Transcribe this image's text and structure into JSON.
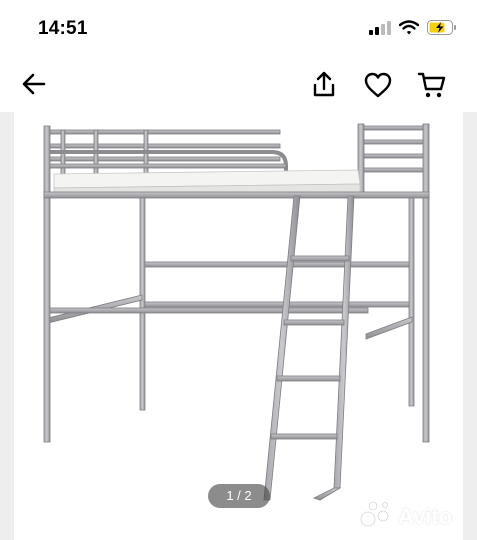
{
  "status_bar": {
    "time": "14:51",
    "signal_icon": "cellular-signal-icon",
    "wifi_icon": "wifi-icon",
    "battery_icon": "battery-charging-icon",
    "battery_color": "#f5d10a"
  },
  "nav_bar": {
    "back_icon": "arrow-left-icon",
    "share_icon": "share-icon",
    "favorite_icon": "heart-icon",
    "cart_icon": "shopping-cart-icon"
  },
  "gallery": {
    "pager_label": "1 / 2",
    "current_index": 1,
    "total": 2,
    "image_subject": "metal loft bed frame with ladder",
    "watermark_text": "Avito"
  }
}
